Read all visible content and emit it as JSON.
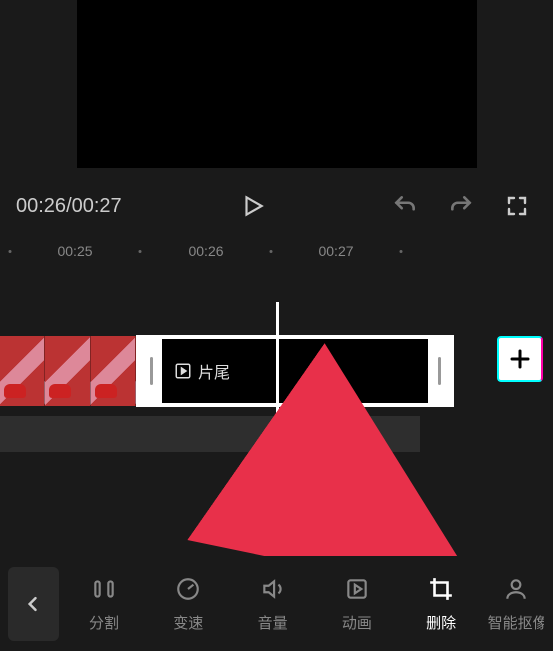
{
  "playback": {
    "current_time": "00:26",
    "total_time": "00:27"
  },
  "ruler": {
    "marks": [
      "00:25",
      "00:26",
      "00:27"
    ]
  },
  "clip": {
    "ending_label": "片尾"
  },
  "toolbar": {
    "split": "分割",
    "speed": "变速",
    "volume": "音量",
    "animate": "动画",
    "delete": "删除",
    "smart": "智能抠像"
  }
}
